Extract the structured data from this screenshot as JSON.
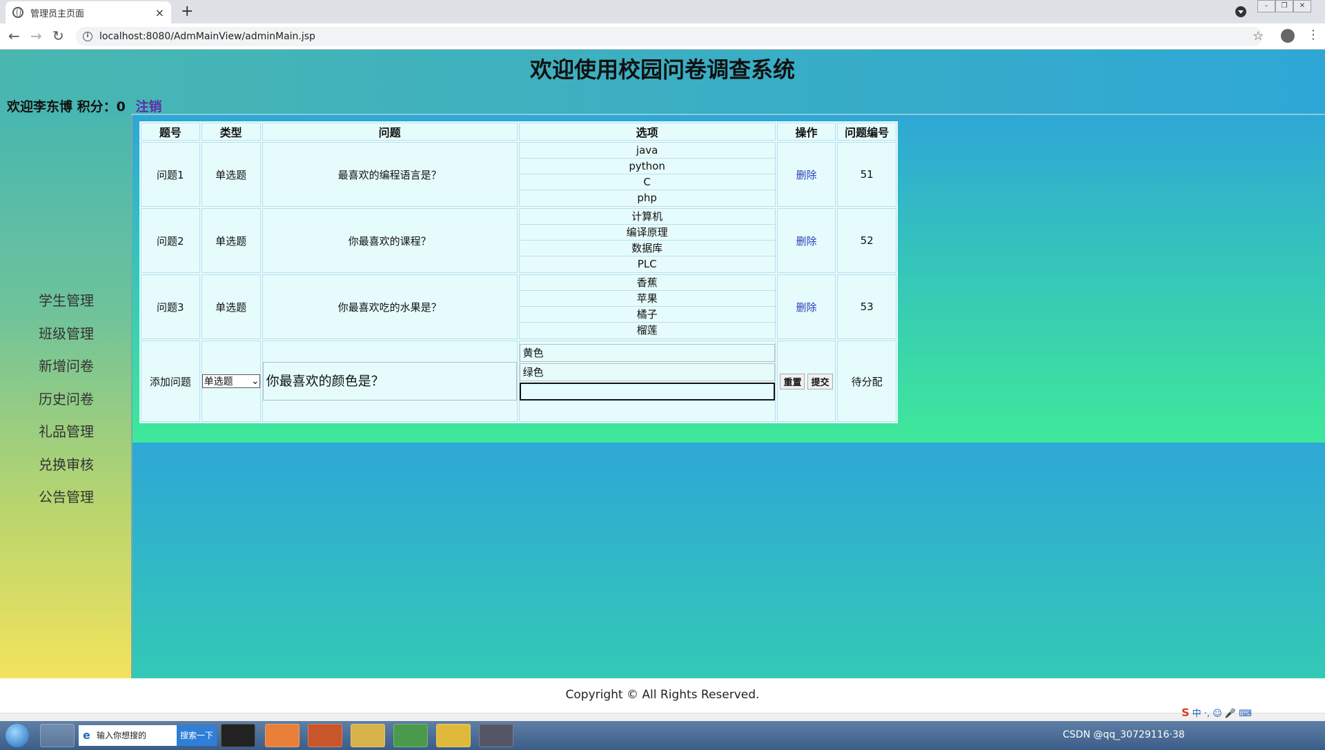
{
  "browser": {
    "tab_title": "管理员主页面",
    "tab_close": "×",
    "new_tab": "+",
    "url": "localhost:8080/AdmMainView/adminMain.jsp",
    "star": "☆",
    "menu": "⋮",
    "back": "←",
    "forward": "→",
    "reload": "↻",
    "info": "i"
  },
  "page": {
    "title": "欢迎使用校园问卷调查系统",
    "welcome": "欢迎李东博  积分：0",
    "logout": "注销"
  },
  "sidebar": {
    "items": [
      {
        "label": "学生管理"
      },
      {
        "label": "班级管理"
      },
      {
        "label": "新增问卷"
      },
      {
        "label": "历史问卷"
      },
      {
        "label": "礼品管理"
      },
      {
        "label": "兑换审核"
      },
      {
        "label": "公告管理"
      }
    ]
  },
  "table": {
    "headers": [
      "题号",
      "类型",
      "问题",
      "选项",
      "操作",
      "问题编号"
    ],
    "rows": [
      {
        "num": "问题1",
        "type": "单选题",
        "question": "最喜欢的编程语言是？",
        "options": [
          "java",
          "python",
          "C",
          "php"
        ],
        "action": "删除",
        "id": "51"
      },
      {
        "num": "问题2",
        "type": "单选题",
        "question": "你最喜欢的课程？",
        "options": [
          "计算机",
          "编译原理",
          "数据库",
          "PLC"
        ],
        "action": "删除",
        "id": "52"
      },
      {
        "num": "问题3",
        "type": "单选题",
        "question": "你最喜欢吃的水果是？",
        "options": [
          "香蕉",
          "苹果",
          "橘子",
          "榴莲"
        ],
        "action": "删除",
        "id": "53"
      }
    ],
    "add_row": {
      "num": "添加问题",
      "type_selected": "单选题",
      "question_value": "你最喜欢的颜色是？",
      "option_values": [
        "黄色",
        "绿色",
        ""
      ],
      "reset": "重置",
      "submit": "提交",
      "id": "待分配"
    }
  },
  "footer": {
    "copyright": "Copyright © All Rights Reserved."
  },
  "taskbar": {
    "search_placeholder": "输入你想搜的",
    "search_button": "搜索一下",
    "ime": "中 ·, ☺ 🎤 ⌨",
    "tray_text": "CSDN @qq_30729116·38"
  }
}
